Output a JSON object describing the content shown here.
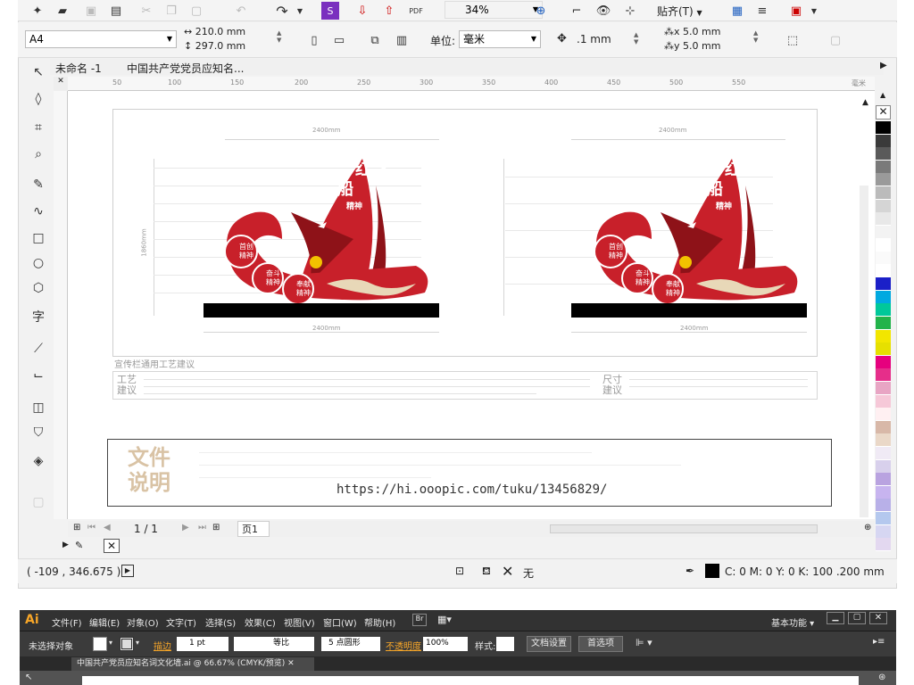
{
  "toolbar1": {
    "zoom": "34%",
    "snap_label": "贴齐(T)"
  },
  "toolbar2": {
    "page_size": "A4",
    "width": "210.0 mm",
    "height": "297.0 mm",
    "units_label": "单位:",
    "units_value": "毫米",
    "nudge": ".1 mm",
    "dup_x": "5.0 mm",
    "dup_y": "5.0 mm"
  },
  "doc_tabs": [
    "未命名 -1",
    "中国共产党党员应知名..."
  ],
  "ruler_ticks": [
    "50",
    "100",
    "150",
    "200",
    "250",
    "300",
    "350",
    "400",
    "450",
    "500",
    "550",
    "毫米"
  ],
  "design": {
    "dim_top": "2400mm",
    "dim_bottom": "2400mm",
    "dim_side": "1860mm",
    "red_chars_1": "红",
    "red_chars_2": "船",
    "slogan": "精神",
    "circle1_top": "首创",
    "circle1_bottom": "精神",
    "circle2_top": "奋斗",
    "circle2_bottom": "精神",
    "circle3_top": "奉献",
    "circle3_bottom": "精神",
    "process_title": "宣传栏通用工艺建议",
    "label_craft_1": "工艺",
    "label_craft_2": "建议",
    "label_size_1": "尺寸",
    "label_size_2": "建议",
    "doc_note_1": "文件",
    "doc_note_2": "说明",
    "url": "https://hi.ooopic.com/tuku/13456829/"
  },
  "page_nav": {
    "counter": "1 / 1",
    "page_tab": "页1"
  },
  "status": {
    "coords": "( -109 , 346.675 )",
    "fill_none": "无",
    "color_readout": "C: 0 M: 0 Y: 0 K: 100  .200 mm"
  },
  "ai_app": {
    "logo": "Ai",
    "menu": [
      "文件(F)",
      "编辑(E)",
      "对象(O)",
      "文字(T)",
      "选择(S)",
      "效果(C)",
      "视图(V)",
      "窗口(W)",
      "帮助(H)"
    ],
    "workspace": "基本功能",
    "ctrl_no_selection": "未选择对象",
    "ctrl_stroke": "描边",
    "ctrl_stroke_value": "1 pt",
    "ctrl_dash": "等比",
    "ctrl_brush": "5 点圆形",
    "ctrl_opacity": "不透明度",
    "ctrl_opacity_value": "100%",
    "ctrl_style": "样式:",
    "doc_settings": "文档设置",
    "preferences": "首选项",
    "doc_tab": "中国共产党员应知名词文化墙.ai @ 66.67% (CMYK/预览)"
  },
  "palette": [
    "#ffffff",
    "#000000",
    "#3a3a3a",
    "#5a5a5a",
    "#7a7a7a",
    "#9a9a9a",
    "#bbbbbb",
    "#d5d5d5",
    "#e8e8e8",
    "#f3f3f3",
    "#ffffff",
    "#fafafa",
    "#ffffff",
    "#1b20c8",
    "#00a9e0",
    "#00c89a",
    "#22b34a",
    "#f2e600",
    "#e6e000",
    "#e6007e",
    "#e62e8a",
    "#e8a5c4",
    "#f6c8d8",
    "#fff0f2",
    "#d8b8a8",
    "#ead8c8",
    "#f0eaf5",
    "#d8d0ec",
    "#b9a3e0",
    "#c7b4ef",
    "#b8b0e8",
    "#b4c8ee",
    "#d6d6f2",
    "#e3d8f0"
  ],
  "colors": {
    "design_red": "#c8202a",
    "dark_red": "#8e1218",
    "cream": "#e8d8b8",
    "app_dark": "#2e2e2e"
  }
}
